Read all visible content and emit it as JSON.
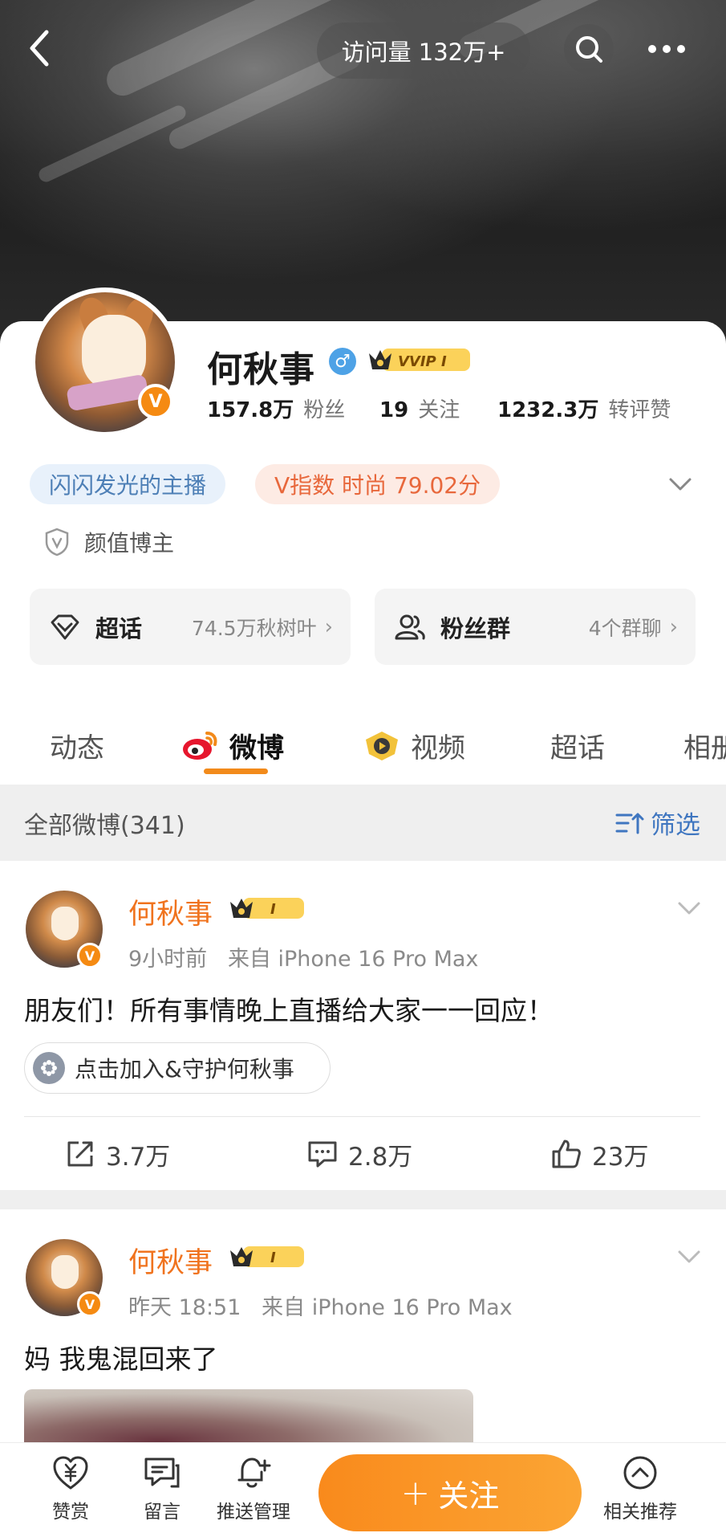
{
  "header": {
    "visit_label": "访问量 132万+"
  },
  "profile": {
    "name": "何秋事",
    "vip_badge": "VVIP I",
    "verified_mark": "V",
    "stats": [
      {
        "value": "157.8万",
        "label": "粉丝"
      },
      {
        "value": "19",
        "label": "关注"
      },
      {
        "value": "1232.3万",
        "label": "转评赞"
      }
    ],
    "tags": [
      "闪闪发光的主播",
      "V指数 时尚 79.02分"
    ],
    "beauty_label": "颜值博主",
    "super_topic": {
      "title": "超话",
      "sub": "74.5万秋树叶"
    },
    "fan_group": {
      "title": "粉丝群",
      "sub": "4个群聊"
    }
  },
  "tabs": [
    "动态",
    "微博",
    "视频",
    "超话",
    "相册"
  ],
  "filter": {
    "all_label": "全部微博(341)",
    "filter_label": "筛选"
  },
  "posts": [
    {
      "name": "何秋事",
      "badge": "I",
      "time": "9小时前",
      "source": "来自 iPhone 16 Pro Max",
      "text": "朋友们！所有事情晚上直播给大家一一回应！",
      "join_label": "点击加入&守护何秋事",
      "reposts": "3.7万",
      "comments": "2.8万",
      "likes": "23万"
    },
    {
      "name": "何秋事",
      "badge": "I",
      "time": "昨天 18:51",
      "source": "来自 iPhone 16 Pro Max",
      "text": "妈 我鬼混回来了"
    }
  ],
  "bottom": {
    "reward": "赞赏",
    "message": "留言",
    "push": "推送管理",
    "follow": "关注",
    "follow_plus": "+",
    "recommend": "相关推荐"
  },
  "colors": {
    "accent_orange": "#f0731e",
    "follow_gradient_start": "#f98a1c",
    "link_blue": "#3f76c0"
  }
}
